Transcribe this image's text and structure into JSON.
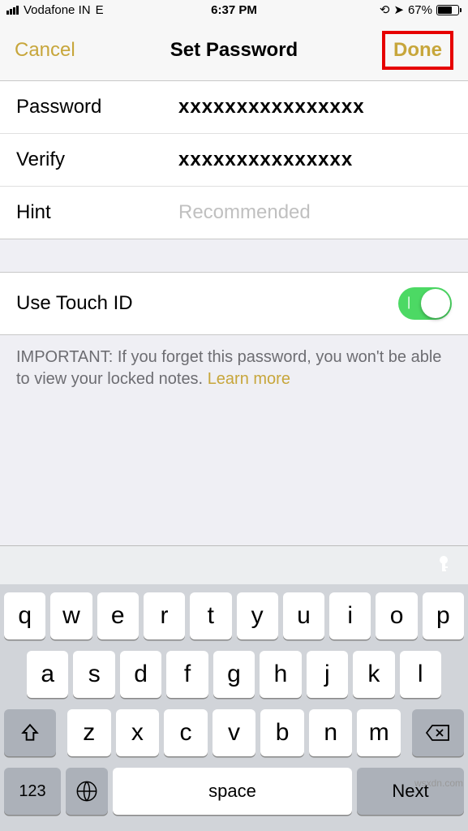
{
  "status": {
    "carrier": "Vodafone IN",
    "network": "E",
    "time": "6:37 PM",
    "battery_pct": "67%"
  },
  "nav": {
    "cancel": "Cancel",
    "title": "Set Password",
    "done": "Done"
  },
  "form": {
    "password_label": "Password",
    "password_value": "xxxxxxxxxxxxxxxx",
    "verify_label": "Verify",
    "verify_value": "xxxxxxxxxxxxxxx",
    "hint_label": "Hint",
    "hint_placeholder": "Recommended"
  },
  "touchid": {
    "label": "Use Touch ID",
    "on": true
  },
  "important": {
    "text": "IMPORTANT: If you forget this password, you won't be able to view your locked notes.",
    "learn_more": "Learn more"
  },
  "keyboard": {
    "r1": [
      "q",
      "w",
      "e",
      "r",
      "t",
      "y",
      "u",
      "i",
      "o",
      "p"
    ],
    "r2": [
      "a",
      "s",
      "d",
      "f",
      "g",
      "h",
      "j",
      "k",
      "l"
    ],
    "r3": [
      "z",
      "x",
      "c",
      "v",
      "b",
      "n",
      "m"
    ],
    "numkey": "123",
    "space": "space",
    "next": "Next"
  },
  "watermark": "wsxdn.com"
}
